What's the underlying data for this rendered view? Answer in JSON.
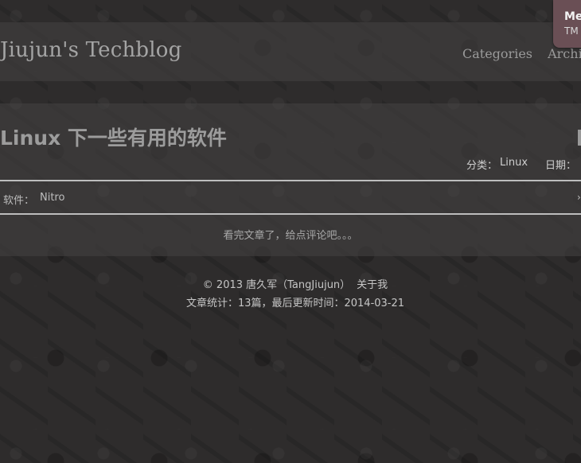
{
  "header": {
    "site_title": "Jiujun's Techblog",
    "nav": [
      {
        "label": "Categories"
      },
      {
        "label": "Archive"
      }
    ]
  },
  "badge": {
    "title": "Me",
    "subtitle": "TM"
  },
  "post": {
    "title": "Linux 下一些有用的软件",
    "category_label": "分类：",
    "category_value": "Linux",
    "date_label": "日期：",
    "tag_label": "软件：",
    "tag_value": "Nitro",
    "tag_end": "›",
    "comment_prompt": "看完文章了，给点评论吧。。。"
  },
  "footer": {
    "copyright": "© 2013 唐久军（TangJiujun）",
    "about_link": "关于我",
    "stats": "文章统计：13篇，最后更新时间：2014-03-21"
  },
  "colors": {
    "background": "#2e2c2c",
    "panel": "#464444",
    "badge": "#6a4f55",
    "text": "#bdbdbd"
  }
}
